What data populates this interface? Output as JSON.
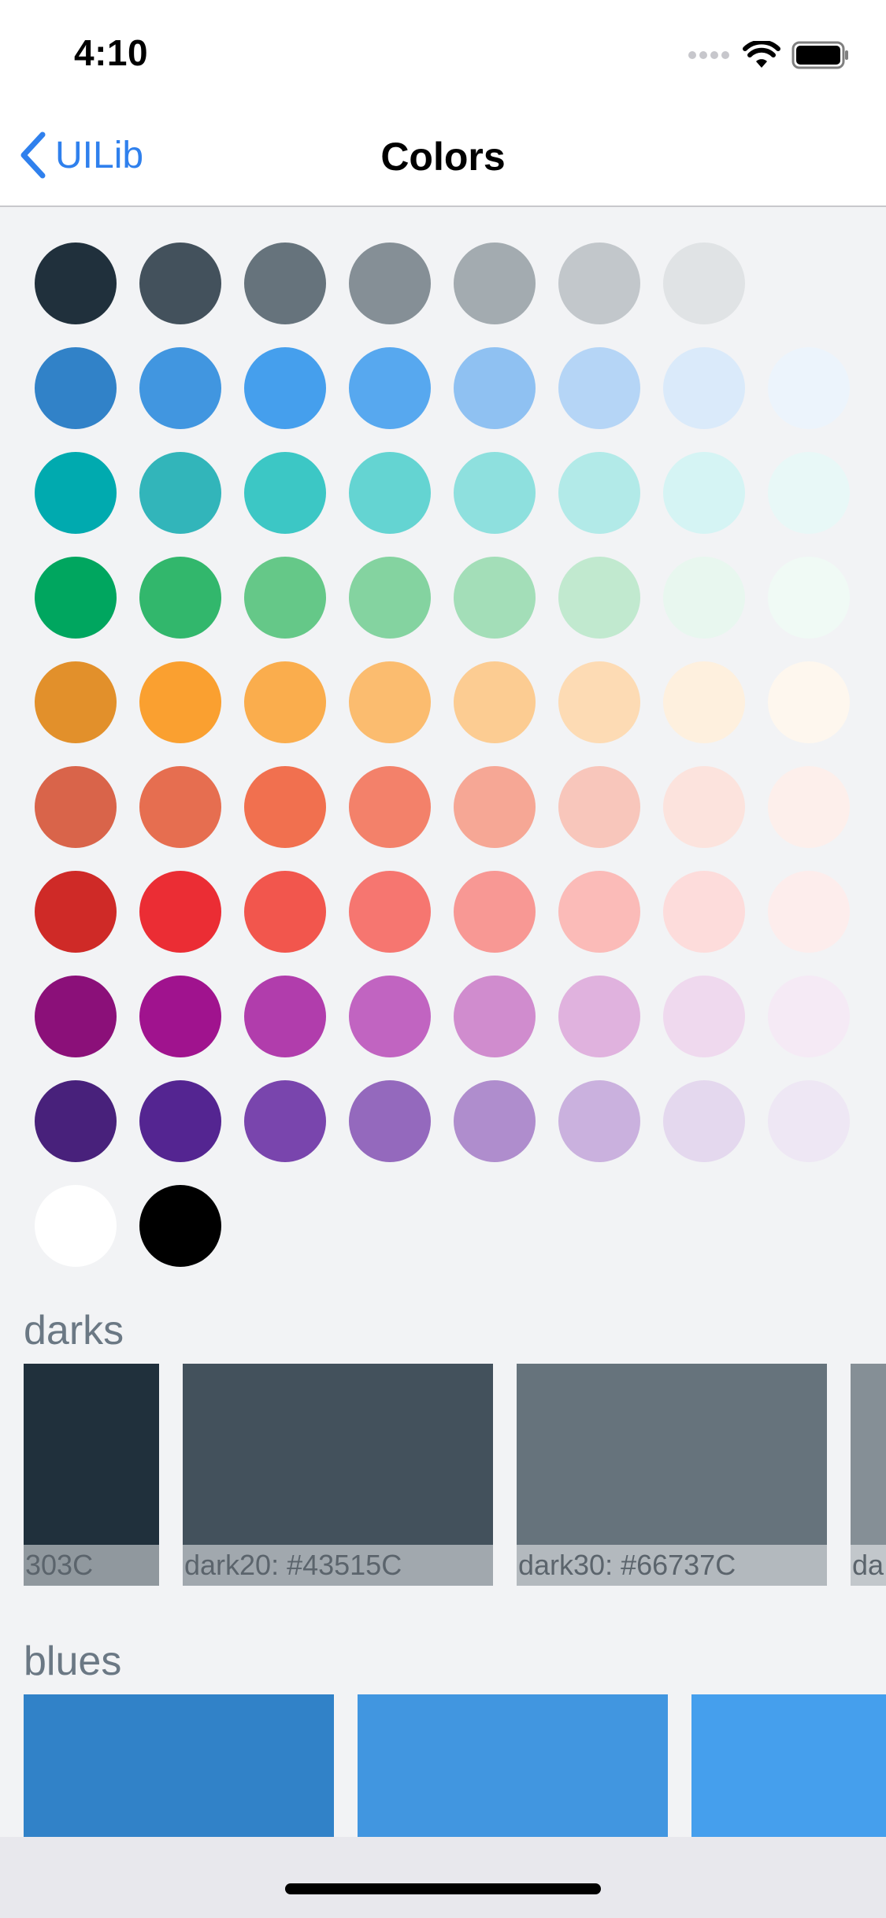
{
  "status": {
    "time": "4:10",
    "icons": [
      "signal-dots-icon",
      "wifi-icon",
      "battery-icon"
    ]
  },
  "nav": {
    "back_label": "UILib",
    "back_icon": "chevron-left-icon",
    "title": "Colors",
    "accent": "#2F80ED"
  },
  "palette": [
    [
      "#20303C",
      "#43515C",
      "#66737C",
      "#858F96",
      "#A3ABB0",
      "#C2C7CB",
      "#E0E3E5"
    ],
    [
      "#3182C8",
      "#4196E0",
      "#459FED",
      "#57A8EF",
      "#8FC1F2",
      "#B5D5F6",
      "#DAEAFA",
      "#ECF4FC"
    ],
    [
      "#00AAAF",
      "#32B5BA",
      "#3CC7C5",
      "#64D4D2",
      "#8EE0DE",
      "#B2EAE8",
      "#D5F4F4",
      "#E8F8F7"
    ],
    [
      "#00A65F",
      "#32B76C",
      "#65C888",
      "#84D3A0",
      "#A3DEB8",
      "#C1E9CF",
      "#E8F7EF",
      "#F0FAF5"
    ],
    [
      "#E2902B",
      "#FAA030",
      "#FAAD4D",
      "#FBBC6F",
      "#FCCC92",
      "#FDDBB4",
      "#FEF0DE",
      "#FEF7EE"
    ],
    [
      "#D9644A",
      "#E66E50",
      "#F1704F",
      "#F3816A",
      "#F6A795",
      "#F8C6BB",
      "#FCE3DD",
      "#FDEFEB"
    ],
    [
      "#CF2A27",
      "#EB2D34",
      "#F2564D",
      "#F67670",
      "#F89894",
      "#FBBBB8",
      "#FDDCDB",
      "#FDEDEC"
    ],
    [
      "#8B1079",
      "#A0138E",
      "#B13DAC",
      "#C164C1",
      "#D08CCE",
      "#E0B2DE",
      "#EFD9EE",
      "#F5EAF5"
    ],
    [
      "#48217B",
      "#542591",
      "#7945AD",
      "#9469BD",
      "#AF8DCD",
      "#CAB1DE",
      "#E4D8EE",
      "#EEE7F4"
    ],
    [
      "#FFFFFF",
      "#000000"
    ]
  ],
  "sections": [
    {
      "title": "darks",
      "swatches": [
        {
          "label": "303C",
          "color": "#20303C"
        },
        {
          "label": "dark20: #43515C",
          "color": "#43515C"
        },
        {
          "label": "dark30: #66737C",
          "color": "#66737C"
        },
        {
          "label": "da",
          "color": "#858F96"
        }
      ]
    },
    {
      "title": "blues",
      "swatches": [
        {
          "label": "",
          "color": "#3182C8"
        },
        {
          "label": "",
          "color": "#4196E0"
        },
        {
          "label": "",
          "color": "#459FED"
        }
      ]
    }
  ]
}
